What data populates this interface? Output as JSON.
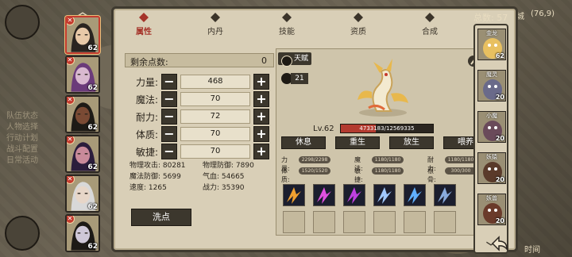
{
  "total": {
    "label": "总数:",
    "value": "57"
  },
  "map": {
    "zone": "城",
    "coords": "(76,9)",
    "bottom_text": "时间"
  },
  "left_hud": {
    "lines": [
      "队伍状态",
      "人物选择",
      "行动计划",
      "战斗配置",
      "日常活动"
    ]
  },
  "hero_roster": [
    {
      "level": "62",
      "selected": true,
      "hair": "#2a2420",
      "skin": "#e8c9a8"
    },
    {
      "level": "62",
      "selected": false,
      "hair": "#6b3b7a",
      "skin": "#d9b9d0"
    },
    {
      "level": "62",
      "selected": false,
      "hair": "#1d1a16",
      "skin": "#7a4a34"
    },
    {
      "level": "62",
      "selected": false,
      "hair": "#2b1d3c",
      "skin": "#c98a9a"
    },
    {
      "level": "62",
      "selected": false,
      "hair": "#d8d8d8",
      "skin": "#e7d6c8"
    },
    {
      "level": "62",
      "selected": false,
      "hair": "#1d1a16",
      "skin": "#cfc8d8"
    }
  ],
  "tabs": [
    {
      "label": "属性",
      "icon": "flame-icon",
      "active": true
    },
    {
      "label": "内丹",
      "icon": "pill-icon",
      "active": false
    },
    {
      "label": "技能",
      "icon": "skill-icon",
      "active": false
    },
    {
      "label": "资质",
      "icon": "aptitude-icon",
      "active": false
    },
    {
      "label": "合成",
      "icon": "merge-icon",
      "active": false
    }
  ],
  "stats": {
    "remain_label": "剩余点数:",
    "remain_value": "0",
    "rows": [
      {
        "label": "力量:",
        "value": "468"
      },
      {
        "label": "魔法:",
        "value": "70"
      },
      {
        "label": "耐力:",
        "value": "72"
      },
      {
        "label": "体质:",
        "value": "70"
      },
      {
        "label": "敏捷:",
        "value": "70"
      }
    ],
    "derived": {
      "phys_atk": "物理攻击: 80281",
      "phys_def": "物理防御: 7890",
      "mag_def": "魔法防御: 5699",
      "hp": "气血: 54665",
      "speed": "速度: 1265",
      "power": "战力: 35390"
    },
    "reset_label": "洗点"
  },
  "pet": {
    "tag": "天赋",
    "paw_value": "21",
    "level": "Lv.62",
    "xp_text": "4733183/12569335",
    "xp_fraction": 0.377,
    "buttons": [
      "休息",
      "重生",
      "放生",
      "喂养"
    ],
    "attrs": [
      {
        "k": "力量:",
        "v": "2298/2298"
      },
      {
        "k": "魔法:",
        "v": "1180/1180"
      },
      {
        "k": "耐力:",
        "v": "1180/1180"
      },
      {
        "k": "体质:",
        "v": "1520/1520"
      },
      {
        "k": "敏捷:",
        "v": "1180/1180"
      },
      {
        "k": "根骨:",
        "v": "300/300"
      }
    ],
    "skills_filled": 6,
    "skills_total": 12,
    "skill_colors": [
      "#f0a030",
      "#e050e0",
      "#c040e0",
      "#a0c8ff",
      "#60b0ff",
      "#88aadd"
    ]
  },
  "pet_roster": [
    {
      "name": "金龙",
      "level": "62",
      "color": "#e8c060"
    },
    {
      "name": "魔灵",
      "level": "20",
      "color": "#6a6a8a"
    },
    {
      "name": "小魔",
      "level": "20",
      "color": "#6a4a5a"
    },
    {
      "name": "妖猿",
      "level": "20",
      "color": "#5a3a2a"
    },
    {
      "name": "妖兽",
      "level": "20",
      "color": "#6a3a2a"
    }
  ]
}
